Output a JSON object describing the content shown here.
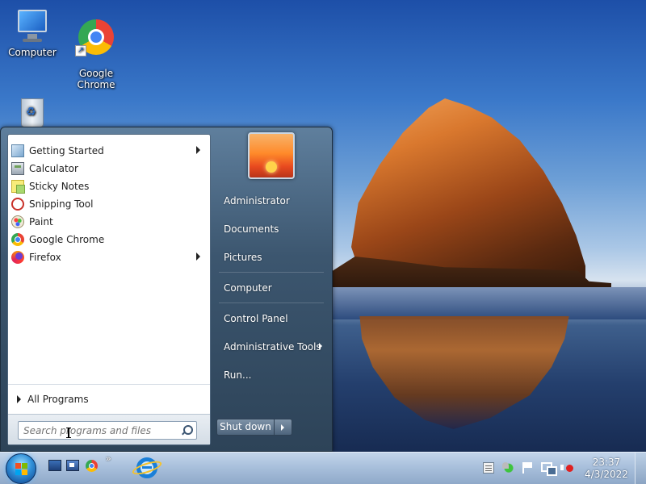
{
  "desktop": {
    "icons": [
      {
        "label": "Computer",
        "icon": "computer-icon"
      },
      {
        "label": "Google\nChrome",
        "icon": "chrome-icon"
      },
      {
        "label": "",
        "icon": "recycle-bin-icon"
      }
    ]
  },
  "start_menu": {
    "programs": [
      {
        "label": "Getting Started",
        "icon": "getting-started-icon",
        "has_submenu": true
      },
      {
        "label": "Calculator",
        "icon": "calculator-icon",
        "has_submenu": false
      },
      {
        "label": "Sticky Notes",
        "icon": "sticky-notes-icon",
        "has_submenu": false
      },
      {
        "label": "Snipping Tool",
        "icon": "snipping-tool-icon",
        "has_submenu": false
      },
      {
        "label": "Paint",
        "icon": "paint-icon",
        "has_submenu": false
      },
      {
        "label": "Google Chrome",
        "icon": "chrome-icon",
        "has_submenu": false
      },
      {
        "label": "Firefox",
        "icon": "firefox-icon",
        "has_submenu": true
      }
    ],
    "all_programs_label": "All Programs",
    "search": {
      "placeholder": "Search programs and files",
      "value": ""
    },
    "right_items": [
      {
        "label": "Administrator",
        "has_submenu": false
      },
      {
        "label": "Documents",
        "has_submenu": false
      },
      {
        "label": "Pictures",
        "has_submenu": false
      },
      {
        "label": "Computer",
        "has_submenu": false
      },
      {
        "label": "Control Panel",
        "has_submenu": false
      },
      {
        "label": "Administrative Tools",
        "has_submenu": true
      },
      {
        "label": "Run...",
        "has_submenu": false
      }
    ],
    "shutdown_label": "Shut down"
  },
  "taskbar": {
    "quick_launch": [
      "show-desktop-icon",
      "switch-windows-icon",
      "chrome-icon"
    ],
    "more_label": "»",
    "pinned": [
      "internet-explorer-icon"
    ],
    "tray": [
      "action-center-icon",
      "security-shield-icon",
      "flag-icon",
      "network-icon",
      "volume-muted-icon"
    ],
    "clock": {
      "time": "23:37",
      "date": "4/3/2022"
    }
  },
  "colors": {
    "start_menu_bg": "#3c566f",
    "taskbar_bg": "#a9c0dc",
    "accent": "#2f8fd8"
  }
}
